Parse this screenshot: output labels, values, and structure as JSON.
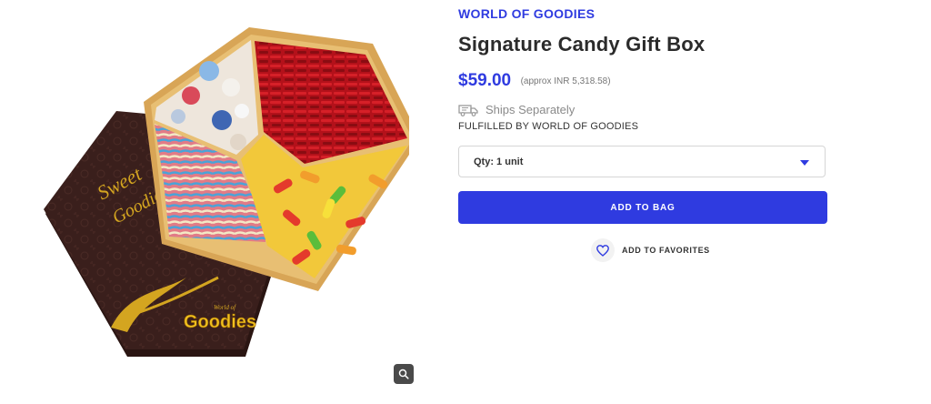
{
  "product": {
    "brand": "WORLD OF GOODIES",
    "title": "Signature Candy Gift Box",
    "price": "$59.00",
    "approx_price": "(approx INR 5,318.58)",
    "shipping_note": "Ships Separately",
    "fulfilled_by": "FULFILLED BY WORLD OF GOODIES",
    "quantity_selected": "Qty: 1 unit",
    "add_to_bag_label": "ADD TO BAG",
    "favorites_label": "ADD TO FAVORITES"
  },
  "image": {
    "lid_text_1": "Sweet",
    "lid_text_2": "Goodies",
    "logo_small": "World of",
    "logo_main": "Goodies"
  },
  "icons": {
    "zoom": "magnifier-icon",
    "truck": "truck-icon",
    "caret": "chevron-down-icon",
    "heart": "heart-icon"
  },
  "colors": {
    "accent": "#2f3be0",
    "text": "#2b2b2b",
    "muted": "#8a8a8a",
    "box_lid": "#3a1f1c",
    "gold": "#d4a520"
  }
}
